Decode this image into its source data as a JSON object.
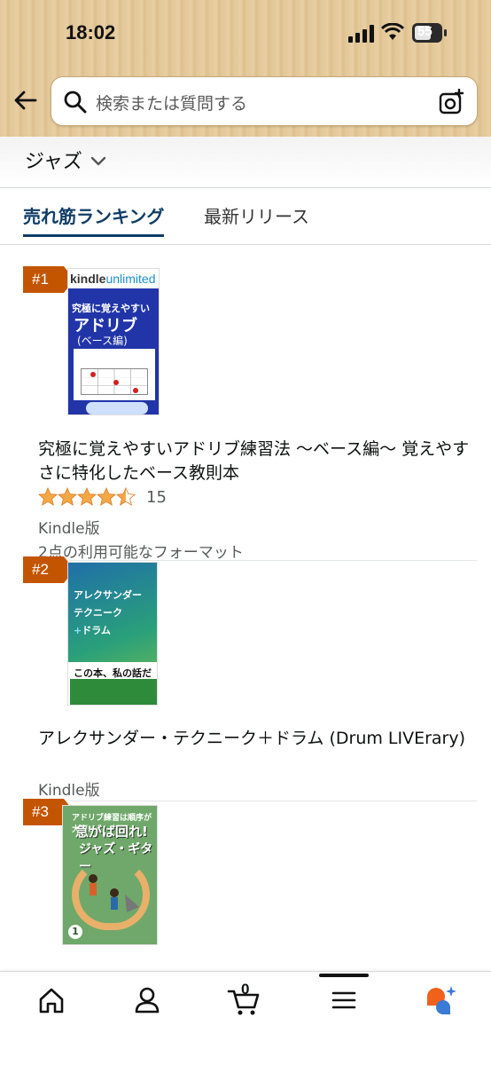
{
  "status_bar": {
    "time": "18:02",
    "battery": "55"
  },
  "header": {
    "search_placeholder": "検索または質問する",
    "icons": {
      "back": "back-arrow-icon",
      "search": "search-icon",
      "camera": "camera-scan-icon"
    }
  },
  "category": {
    "label": "ジャズ"
  },
  "tabs": [
    {
      "label": "売れ筋ランキング",
      "active": true
    },
    {
      "label": "最新リリース",
      "active": false
    }
  ],
  "items": [
    {
      "rank": "#1",
      "cover": {
        "badge_kindle": "kindle",
        "badge_unlimited": "unlimited",
        "line1": "究極に覚えやすい",
        "line2": "アドリブ",
        "line3": "(ベース編)"
      },
      "title": "究極に覚えやすいアドリブ練習法 〜ベース編〜 覚えやすさに特化したベース教則本",
      "rating": 4.5,
      "rating_count": "15",
      "format": "Kindle版",
      "formats_available": "2点の利用可能なフォーマット"
    },
    {
      "rank": "#2",
      "cover": {
        "line1": "アレクサンダー",
        "line2": "テクニーク",
        "line3_plus": "+",
        "line3": "ドラム",
        "tagline": "この本、私の話だ"
      },
      "title": "アレクサンダー・テクニーク＋ドラム (Drum LIVErary)",
      "format": "Kindle版"
    },
    {
      "rank": "#3",
      "cover": {
        "line1": "アドリブ練習は順序が大事!",
        "line2": "急がば回れ!",
        "line3": "ジャズ・ギター",
        "volume": "1"
      }
    }
  ],
  "bottom_nav": {
    "cart_count": "0",
    "icons": [
      "home-icon",
      "account-icon",
      "cart-icon",
      "menu-icon",
      "rufus-assistant-icon"
    ]
  },
  "colors": {
    "rank_badge": "#c45500",
    "star": "#f3a847",
    "active_tab": "#0f3d66"
  }
}
